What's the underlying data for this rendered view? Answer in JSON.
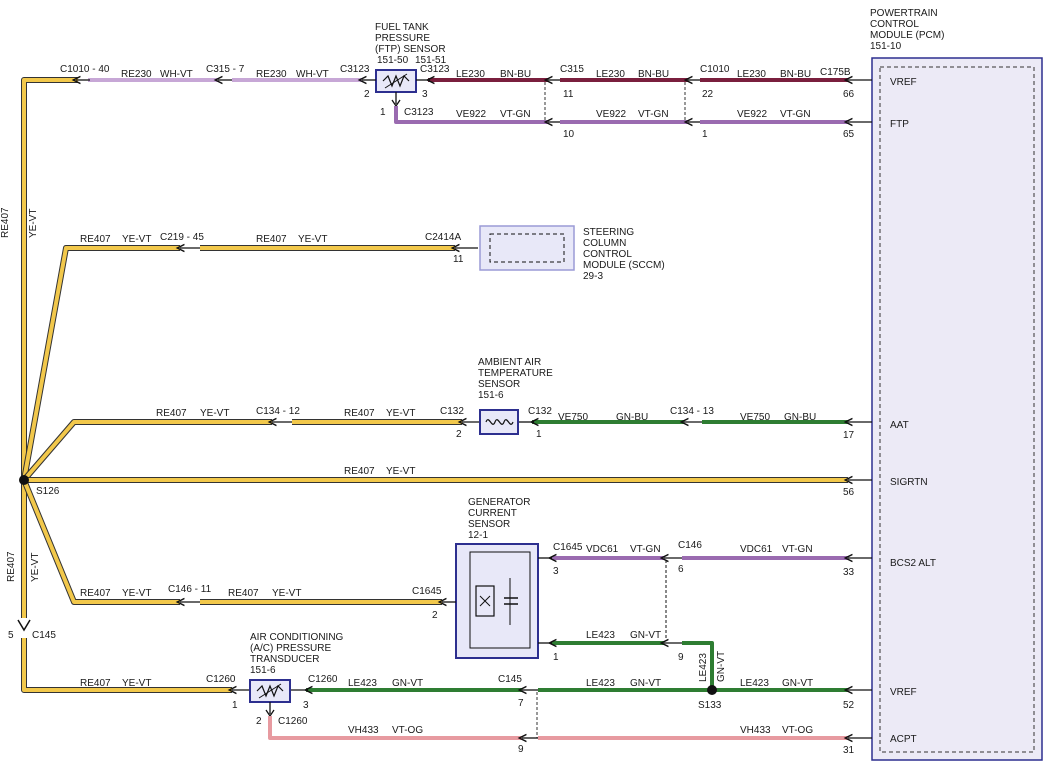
{
  "pcm": {
    "title_lines": [
      "POWERTRAIN",
      "CONTROL",
      "MODULE (PCM)",
      "151-10"
    ],
    "pins": [
      {
        "label": "VREF",
        "pin": "66"
      },
      {
        "label": "FTP",
        "pin": "65"
      },
      {
        "label": "AAT",
        "pin": "17"
      },
      {
        "label": "SIGRTN",
        "pin": "56"
      },
      {
        "label": "BCS2 ALT",
        "pin": "33"
      },
      {
        "label": "VREF",
        "pin": "52"
      },
      {
        "label": "ACPT",
        "pin": "31"
      }
    ]
  },
  "components": {
    "ftp": {
      "lines": [
        "FUEL TANK",
        "PRESSURE",
        "(FTP) SENSOR"
      ],
      "refs": [
        "151-50",
        "151-51"
      ]
    },
    "sccm": {
      "lines": [
        "STEERING",
        "COLUMN",
        "CONTROL",
        "MODULE (SCCM)",
        "29-3"
      ]
    },
    "aat": {
      "lines": [
        "AMBIENT AIR",
        "TEMPERATURE",
        "SENSOR",
        "151-6"
      ]
    },
    "gcs": {
      "lines": [
        "GENERATOR",
        "CURRENT",
        "SENSOR",
        "12-1"
      ]
    },
    "acp": {
      "lines": [
        "AIR CONDITIONING",
        "(A/C) PRESSURE",
        "TRANSDUCER",
        "151-6"
      ]
    }
  },
  "splices": {
    "s126": "S126",
    "s133": "S133",
    "c145": "C145",
    "c145_pin": "5"
  },
  "trunk": {
    "upper": {
      "circuit": "RE407",
      "color": "YE-VT"
    },
    "lower": {
      "circuit": "RE407",
      "color": "YE-VT"
    }
  },
  "rows": [
    {
      "id": "vref-top",
      "connectors": [
        "C1010 - 40",
        "C315 - 7",
        "C3123",
        "C3123",
        "C315",
        "C1010",
        "C175B"
      ],
      "pins": [
        "2",
        "3",
        "11",
        "22",
        "66"
      ],
      "segments": [
        {
          "circuit": "RE230",
          "color": "WH-VT"
        },
        {
          "circuit": "RE230",
          "color": "WH-VT"
        },
        {
          "circuit": "LE230",
          "color": "BN-BU"
        },
        {
          "circuit": "LE230",
          "color": "BN-BU"
        },
        {
          "circuit": "LE230",
          "color": "BN-BU"
        }
      ]
    },
    {
      "id": "ftp",
      "connectors": [
        "C3123"
      ],
      "pins": [
        "1",
        "10",
        "1",
        "65"
      ],
      "segments": [
        {
          "circuit": "VE922",
          "color": "VT-GN"
        },
        {
          "circuit": "VE922",
          "color": "VT-GN"
        },
        {
          "circuit": "VE922",
          "color": "VT-GN"
        }
      ]
    },
    {
      "id": "sccm",
      "connectors": [
        "C219 - 45",
        "C2414A"
      ],
      "pins": [
        "11"
      ],
      "segments": [
        {
          "circuit": "RE407",
          "color": "YE-VT"
        },
        {
          "circuit": "RE407",
          "color": "YE-VT"
        }
      ]
    },
    {
      "id": "aat",
      "connectors": [
        "C134 - 12",
        "C132",
        "C132",
        "C134 - 13"
      ],
      "pins": [
        "2",
        "1",
        "17"
      ],
      "segments": [
        {
          "circuit": "RE407",
          "color": "YE-VT"
        },
        {
          "circuit": "RE407",
          "color": "YE-VT"
        },
        {
          "circuit": "VE750",
          "color": "GN-BU"
        },
        {
          "circuit": "VE750",
          "color": "GN-BU"
        }
      ]
    },
    {
      "id": "sigrtn",
      "connectors": [],
      "pins": [
        "56"
      ],
      "segments": [
        {
          "circuit": "RE407",
          "color": "YE-VT"
        }
      ]
    },
    {
      "id": "bcs",
      "connectors": [
        "C1645",
        "C146"
      ],
      "pins": [
        "3",
        "6",
        "33"
      ],
      "segments": [
        {
          "circuit": "VDC61",
          "color": "VT-GN"
        },
        {
          "circuit": "VDC61",
          "color": "VT-GN"
        }
      ]
    },
    {
      "id": "gcs-sig",
      "connectors": [
        "C146 - 11",
        "C1645"
      ],
      "pins": [
        "2"
      ],
      "segments": [
        {
          "circuit": "RE407",
          "color": "YE-VT"
        },
        {
          "circuit": "RE407",
          "color": "YE-VT"
        }
      ]
    },
    {
      "id": "gcs-vref",
      "connectors": [],
      "pins": [
        "1",
        "9"
      ],
      "segments": [
        {
          "circuit": "LE423",
          "color": "GN-VT"
        },
        {
          "circuit": "LE423",
          "color": "GN-VT"
        }
      ]
    },
    {
      "id": "vref-bottom",
      "connectors": [
        "C1260",
        "C1260",
        "C145"
      ],
      "pins": [
        "1",
        "3",
        "7",
        "52"
      ],
      "segments": [
        {
          "circuit": "RE407",
          "color": "YE-VT"
        },
        {
          "circuit": "LE423",
          "color": "GN-VT"
        },
        {
          "circuit": "LE423",
          "color": "GN-VT"
        },
        {
          "circuit": "LE423",
          "color": "GN-VT"
        }
      ]
    },
    {
      "id": "acpt",
      "connectors": [
        "C1260"
      ],
      "pins": [
        "2",
        "9",
        "31"
      ],
      "segments": [
        {
          "circuit": "VH433",
          "color": "VT-OG"
        },
        {
          "circuit": "VH433",
          "color": "VT-OG"
        }
      ]
    }
  ],
  "wire_colors": {
    "ye_vt": "#f2c84b",
    "wh_vt": "#c7a7d6",
    "bn_bu": "#7a1f3d",
    "vt_gn": "#9a6bb0",
    "gn_bu": "#2e7d32",
    "gn_vt": "#2e7d32",
    "vt_og": "#e79aa0",
    "module_fill": "#e8e8f8",
    "module_border": "#2d2f8f"
  }
}
